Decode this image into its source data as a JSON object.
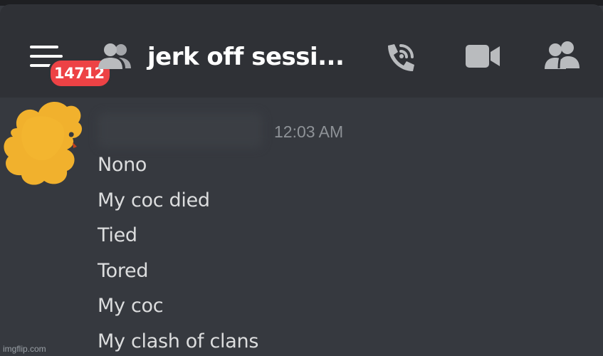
{
  "header": {
    "menu_icon": "hamburger-menu-icon",
    "unread_badge": "14712",
    "channel_icon": "group-dm-icon",
    "channel_title": "jerk off sessi...",
    "actions": [
      {
        "icon": "voice-call-icon"
      },
      {
        "icon": "video-call-icon"
      },
      {
        "icon": "member-list-icon"
      }
    ]
  },
  "message_group": {
    "avatar": "avatar-scribbled",
    "timestamp": "12:03 AM",
    "messages": [
      "Nono",
      "My coc died",
      "Tied",
      "Tored",
      "My coc",
      "My clash of clans"
    ]
  },
  "watermark": "imgflip.com",
  "colors": {
    "background": "#36393f",
    "header": "#2f3136",
    "badge": "#ed4245",
    "text": "#dcddde",
    "muted": "#8e9297",
    "avatar_scribble": "#f1b12d"
  }
}
